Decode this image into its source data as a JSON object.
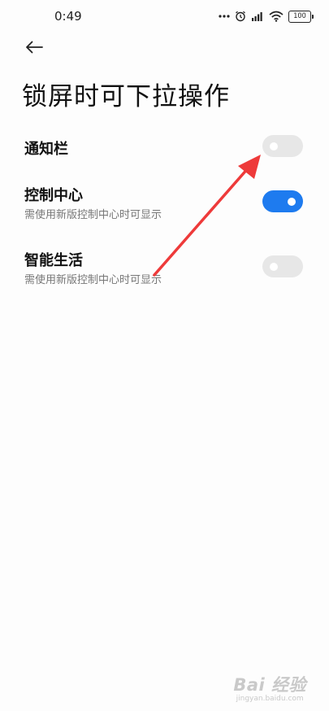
{
  "status_bar": {
    "time": "0:49",
    "battery": "100",
    "icons": [
      "dots-icon",
      "alarm-icon",
      "signal-icon",
      "wifi-icon",
      "battery-icon"
    ]
  },
  "header": {
    "back_icon": "back-arrow-icon",
    "title": "锁屏时可下拉操作"
  },
  "settings": [
    {
      "title": "通知栏",
      "subtitle": "",
      "enabled": false
    },
    {
      "title": "控制中心",
      "subtitle": "需使用新版控制中心时可显示",
      "enabled": true
    },
    {
      "title": "智能生活",
      "subtitle": "需使用新版控制中心时可显示",
      "enabled": false
    }
  ],
  "annotation": {
    "color": "#ee3a3a"
  },
  "watermark": {
    "brand": "Bai 经验",
    "url": "jingyan.baidu.com"
  },
  "colors": {
    "toggle_on": "#1e7bef",
    "toggle_off": "#e7e7e7",
    "arrow": "#ee3a3a"
  }
}
